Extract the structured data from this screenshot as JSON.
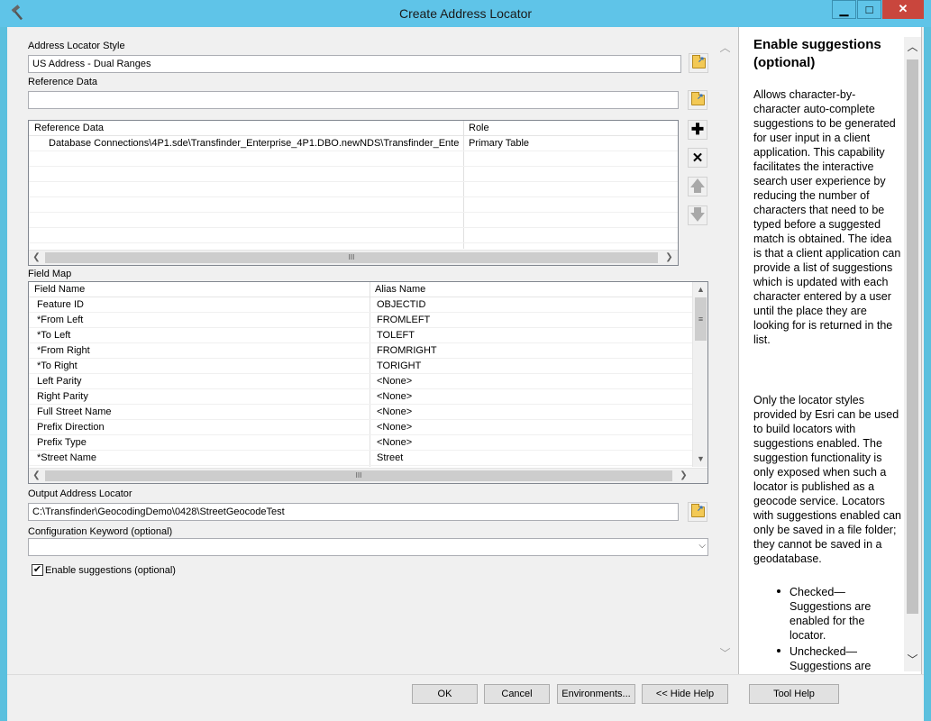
{
  "window": {
    "title": "Create Address Locator",
    "minimize": "▁",
    "maximize": "□",
    "close": "✕"
  },
  "form": {
    "locator_style_label": "Address Locator Style",
    "locator_style_value": "US Address - Dual Ranges",
    "reference_data_label": "Reference Data",
    "reference_data_value": "",
    "ref_table": {
      "headers": [
        "Reference Data",
        "Role"
      ],
      "rows": [
        {
          "data": "Database Connections\\4P1.sde\\Transfinder_Enterprise_4P1.DBO.newNDS\\Transfinder_Ente...",
          "role": "Primary Table"
        }
      ],
      "scroll_thumb": "III"
    },
    "field_map_label": "Field Map",
    "field_map": {
      "headers": [
        "Field Name",
        "Alias Name"
      ],
      "rows": [
        {
          "field": "Feature ID",
          "alias": "OBJECTID"
        },
        {
          "field": "*From Left",
          "alias": "FROMLEFT"
        },
        {
          "field": "*To Left",
          "alias": "TOLEFT"
        },
        {
          "field": "*From Right",
          "alias": "FROMRIGHT"
        },
        {
          "field": "*To Right",
          "alias": "TORIGHT"
        },
        {
          "field": "Left Parity",
          "alias": "<None>"
        },
        {
          "field": "Right Parity",
          "alias": "<None>"
        },
        {
          "field": "Full Street Name",
          "alias": "<None>"
        },
        {
          "field": "Prefix Direction",
          "alias": "<None>"
        },
        {
          "field": "Prefix Type",
          "alias": "<None>"
        },
        {
          "field": "*Street Name",
          "alias": "Street"
        }
      ],
      "scroll_thumb": "III"
    },
    "output_label": "Output Address Locator",
    "output_value": "C:\\Transfinder\\GeocodingDemo\\0428\\StreetGeocodeTest",
    "config_label": "Configuration Keyword (optional)",
    "config_value": "",
    "suggestions_label": "Enable suggestions (optional)",
    "suggestions_checked": "✔"
  },
  "help": {
    "title": "Enable suggestions (optional)",
    "para1": "Allows character-by-character auto-complete suggestions to be generated for user input in a client application. This capability facilitates the interactive search user experience by reducing the number of characters that need to be typed before a suggested match is obtained. The idea is that a client application can provide a list of suggestions which is updated with each character entered by a user until the place they are looking for is returned in the list.",
    "para2": "Only the locator styles provided by Esri can be used to build locators with suggestions enabled. The suggestion functionality is only exposed when such a locator is published as a geocode service. Locators with suggestions enabled can only be saved in a file folder; they cannot be saved in a geodatabase.",
    "bullets": [
      "Checked—Suggestions are enabled for the locator.",
      "Unchecked—Suggestions are"
    ]
  },
  "buttons": {
    "ok": "OK",
    "cancel": "Cancel",
    "environments": "Environments...",
    "hide_help": "<< Hide Help",
    "tool_help": "Tool Help"
  }
}
